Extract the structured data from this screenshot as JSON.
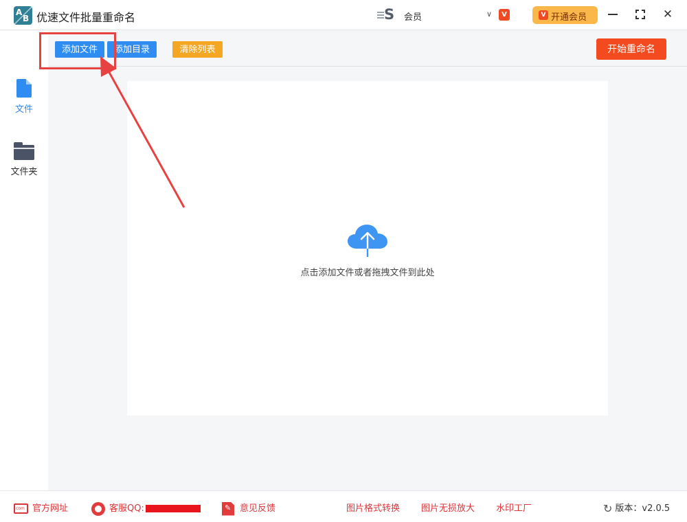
{
  "app": {
    "title": "优速文件批量重命名",
    "logo_letters": [
      "A",
      "B"
    ]
  },
  "header": {
    "user_logo_letter": "S",
    "member_label": "会员",
    "vip_badge": "V",
    "open_vip_label": "开通会员",
    "open_vip_icon": "V"
  },
  "sidebar": {
    "items": [
      {
        "label": "文件",
        "icon": "file-icon",
        "active": true
      },
      {
        "label": "文件夹",
        "icon": "folder-icon",
        "active": false
      }
    ]
  },
  "toolbar": {
    "add_file": "添加文件",
    "add_dir": "添加目录",
    "clear_list": "清除列表",
    "start_rename": "开始重命名"
  },
  "main": {
    "drop_hint": "点击添加文件或者拖拽文件到此处"
  },
  "statusbar": {
    "site": "官方网址",
    "qq": "客服QQ:",
    "feedback": "意见反馈",
    "image_convert": "图片格式转换",
    "image_enlarge": "图片无损放大",
    "watermark": "水印工厂",
    "version": "版本：v2.0.5"
  },
  "colors": {
    "primary_blue": "#2f8cf0",
    "orange": "#f5a623",
    "start_red": "#f34a1f",
    "vip_gold": "#fbb84a",
    "annotation_red": "#e84141"
  }
}
